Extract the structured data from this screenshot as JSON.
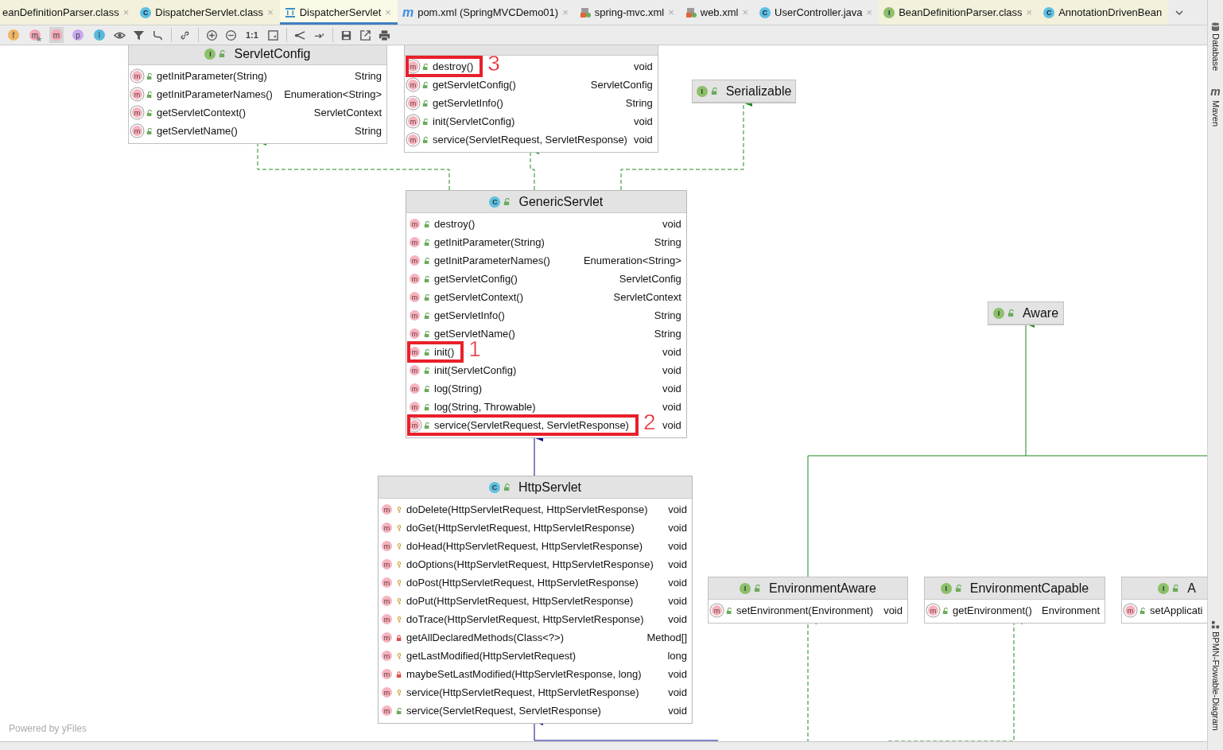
{
  "tabs": [
    {
      "label": "eanDefinitionParser.class",
      "kind": "plain",
      "library": true,
      "selected": false,
      "close": "×"
    },
    {
      "label": "DispatcherServlet.class",
      "kind": "class",
      "icon_text": "C",
      "library": true,
      "selected": false,
      "close": "×"
    },
    {
      "label": "DispatcherServlet",
      "kind": "diagram",
      "library": true,
      "selected": true,
      "close": "×"
    },
    {
      "label": "pom.xml (SpringMVCDemo01)",
      "kind": "maven",
      "icon_text": "m",
      "library": false,
      "selected": false,
      "close": "×"
    },
    {
      "label": "spring-mvc.xml",
      "kind": "xml",
      "library": false,
      "selected": false,
      "close": "×"
    },
    {
      "label": "web.xml",
      "kind": "xml",
      "library": false,
      "selected": false,
      "close": "×"
    },
    {
      "label": "UserController.java",
      "kind": "class",
      "icon_text": "C",
      "library": false,
      "selected": false,
      "close": "×"
    },
    {
      "label": "BeanDefinitionParser.class",
      "kind": "interface",
      "icon_text": "I",
      "library": true,
      "selected": false,
      "close": "×"
    },
    {
      "label": "AnnotationDrivenBean",
      "kind": "class",
      "icon_text": "C",
      "library": true,
      "selected": false
    }
  ],
  "toolbar": [
    {
      "kind": "badge",
      "text": "f",
      "color": "#f0b463",
      "selected": false
    },
    {
      "kind": "badge_star",
      "text": "m",
      "color": "#f4a8b8",
      "selected": false
    },
    {
      "kind": "badge",
      "text": "m",
      "color": "#f4a8b8",
      "selected": true
    },
    {
      "kind": "badge",
      "text": "p",
      "color": "#c9a8f0",
      "selected": false
    },
    {
      "kind": "badge",
      "text": "I",
      "color": "#56b8de",
      "selected": false
    },
    {
      "kind": "eye"
    },
    {
      "kind": "filter"
    },
    {
      "kind": "route"
    },
    {
      "kind": "separator"
    },
    {
      "kind": "link"
    },
    {
      "kind": "separator"
    },
    {
      "kind": "zoom_in"
    },
    {
      "kind": "zoom_out"
    },
    {
      "kind": "text",
      "text": "1:1"
    },
    {
      "kind": "fit"
    },
    {
      "kind": "separator"
    },
    {
      "kind": "layout"
    },
    {
      "kind": "arrow"
    },
    {
      "kind": "separator"
    },
    {
      "kind": "save"
    },
    {
      "kind": "export"
    },
    {
      "kind": "print"
    }
  ],
  "diagram": {
    "nodes": [
      {
        "kind": "interface",
        "badge": "I",
        "title": "ServletConfig",
        "members": [
          {
            "badge": "m",
            "abstract": true,
            "kind": "public",
            "name": "getInitParameter(String)",
            "type": "String"
          },
          {
            "badge": "m",
            "abstract": true,
            "kind": "public",
            "name": "getInitParameterNames()",
            "type": "Enumeration<String>"
          },
          {
            "badge": "m",
            "abstract": true,
            "kind": "public",
            "name": "getServletContext()",
            "type": "ServletContext"
          },
          {
            "badge": "m",
            "abstract": true,
            "kind": "public",
            "name": "getServletName()",
            "type": "String"
          }
        ]
      },
      {
        "kind": "interface",
        "members": [
          {
            "badge": "m",
            "abstract": true,
            "kind": "public",
            "name": "destroy()",
            "type": "void",
            "annotation": "3"
          },
          {
            "badge": "m",
            "abstract": true,
            "kind": "public",
            "name": "getServletConfig()",
            "type": "ServletConfig"
          },
          {
            "badge": "m",
            "abstract": true,
            "kind": "public",
            "name": "getServletInfo()",
            "type": "String"
          },
          {
            "badge": "m",
            "abstract": true,
            "kind": "public",
            "name": "init(ServletConfig)",
            "type": "void"
          },
          {
            "badge": "m",
            "abstract": true,
            "kind": "public",
            "name": "service(ServletRequest, ServletResponse)",
            "type": "void"
          }
        ]
      },
      {
        "kind": "interface",
        "badge": "I",
        "title": "Serializable"
      },
      {
        "kind": "class",
        "badge": "C",
        "title": "GenericServlet",
        "members": [
          {
            "badge": "m",
            "abstract": false,
            "kind": "public",
            "name": "destroy()",
            "type": "void"
          },
          {
            "badge": "m",
            "abstract": false,
            "kind": "public",
            "name": "getInitParameter(String)",
            "type": "String"
          },
          {
            "badge": "m",
            "abstract": false,
            "kind": "public",
            "name": "getInitParameterNames()",
            "type": "Enumeration<String>"
          },
          {
            "badge": "m",
            "abstract": false,
            "kind": "public",
            "name": "getServletConfig()",
            "type": "ServletConfig"
          },
          {
            "badge": "m",
            "abstract": false,
            "kind": "public",
            "name": "getServletContext()",
            "type": "ServletContext"
          },
          {
            "badge": "m",
            "abstract": false,
            "kind": "public",
            "name": "getServletInfo()",
            "type": "String"
          },
          {
            "badge": "m",
            "abstract": false,
            "kind": "public",
            "name": "getServletName()",
            "type": "String"
          },
          {
            "badge": "m",
            "abstract": false,
            "kind": "public",
            "name": "init()",
            "type": "void",
            "annotation": "1"
          },
          {
            "badge": "m",
            "abstract": false,
            "kind": "public",
            "name": "init(ServletConfig)",
            "type": "void"
          },
          {
            "badge": "m",
            "abstract": false,
            "kind": "public",
            "name": "log(String)",
            "type": "void"
          },
          {
            "badge": "m",
            "abstract": false,
            "kind": "public",
            "name": "log(String, Throwable)",
            "type": "void"
          },
          {
            "badge": "m",
            "abstract": true,
            "kind": "public",
            "name": "service(ServletRequest, ServletResponse)",
            "type": "void",
            "annotation": "2"
          }
        ]
      },
      {
        "kind": "class",
        "badge": "C",
        "title": "HttpServlet",
        "members": [
          {
            "badge": "m",
            "abstract": false,
            "kind": "protected",
            "name": "doDelete(HttpServletRequest, HttpServletResponse)",
            "type": "void"
          },
          {
            "badge": "m",
            "abstract": false,
            "kind": "protected",
            "name": "doGet(HttpServletRequest, HttpServletResponse)",
            "type": "void"
          },
          {
            "badge": "m",
            "abstract": false,
            "kind": "protected",
            "name": "doHead(HttpServletRequest, HttpServletResponse)",
            "type": "void"
          },
          {
            "badge": "m",
            "abstract": false,
            "kind": "protected",
            "name": "doOptions(HttpServletRequest, HttpServletResponse)",
            "type": "void"
          },
          {
            "badge": "m",
            "abstract": false,
            "kind": "protected",
            "name": "doPost(HttpServletRequest, HttpServletResponse)",
            "type": "void"
          },
          {
            "badge": "m",
            "abstract": false,
            "kind": "protected",
            "name": "doPut(HttpServletRequest, HttpServletResponse)",
            "type": "void"
          },
          {
            "badge": "m",
            "abstract": false,
            "kind": "protected",
            "name": "doTrace(HttpServletRequest, HttpServletResponse)",
            "type": "void"
          },
          {
            "badge": "m",
            "abstract": false,
            "kind": "private",
            "name": "getAllDeclaredMethods(Class<?>)",
            "type": "Method[]"
          },
          {
            "badge": "m",
            "abstract": false,
            "kind": "protected",
            "name": "getLastModified(HttpServletRequest)",
            "type": "long"
          },
          {
            "badge": "m",
            "abstract": false,
            "kind": "private",
            "name": "maybeSetLastModified(HttpServletResponse, long)",
            "type": "void"
          },
          {
            "badge": "m",
            "abstract": false,
            "kind": "protected",
            "name": "service(HttpServletRequest, HttpServletResponse)",
            "type": "void"
          },
          {
            "badge": "m",
            "abstract": false,
            "kind": "public",
            "name": "service(ServletRequest, ServletResponse)",
            "type": "void"
          }
        ]
      },
      {
        "kind": "interface",
        "badge": "I",
        "title": "Aware"
      },
      {
        "kind": "interface",
        "badge": "I",
        "title": "EnvironmentAware",
        "members": [
          {
            "badge": "m",
            "abstract": true,
            "kind": "public",
            "name": "setEnvironment(Environment)",
            "type": "void"
          }
        ]
      },
      {
        "kind": "interface",
        "badge": "I",
        "title": "EnvironmentCapable",
        "members": [
          {
            "badge": "m",
            "abstract": true,
            "kind": "public",
            "name": "getEnvironment()",
            "type": "Environment"
          }
        ]
      },
      {
        "kind": "interface",
        "badge": "I",
        "title": "A",
        "members": [
          {
            "badge": "m",
            "abstract": true,
            "kind": "public",
            "name": "setApplicati"
          }
        ]
      }
    ],
    "footer": "Powered by yFiles"
  },
  "side_panels_top": [
    {
      "label": "Database",
      "kind": "database"
    },
    {
      "label": "Maven",
      "kind": "maven",
      "icon_text": "m"
    }
  ],
  "side_panels_bottom": [
    {
      "label": "BPMN-Flowable-Diagram",
      "kind": "bpmn"
    }
  ]
}
